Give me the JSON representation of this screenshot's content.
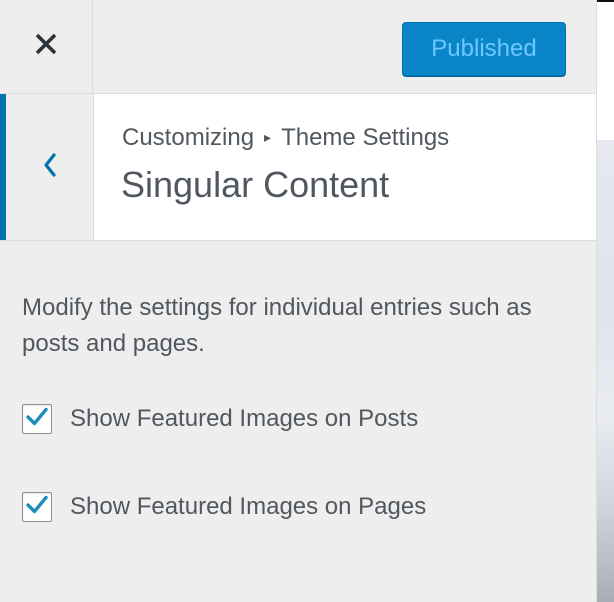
{
  "header": {
    "close_icon": "close-icon",
    "publish_label": "Published"
  },
  "section": {
    "back_icon": "chevron-left-icon",
    "breadcrumb_root": "Customizing",
    "breadcrumb_separator": "▸",
    "breadcrumb_parent": "Theme Settings",
    "title": "Singular Content"
  },
  "content": {
    "description": "Modify the settings for individual entries such as posts and pages.",
    "options": [
      {
        "label": "Show Featured Images on Posts",
        "checked": true
      },
      {
        "label": "Show Featured Images on Pages",
        "checked": true
      }
    ]
  },
  "colors": {
    "accent": "#0073aa",
    "publish_button_bg": "#0a85c7",
    "publish_button_text": "#6ec7ff",
    "text": "#50575e",
    "panel_bg": "#eeeeee"
  }
}
